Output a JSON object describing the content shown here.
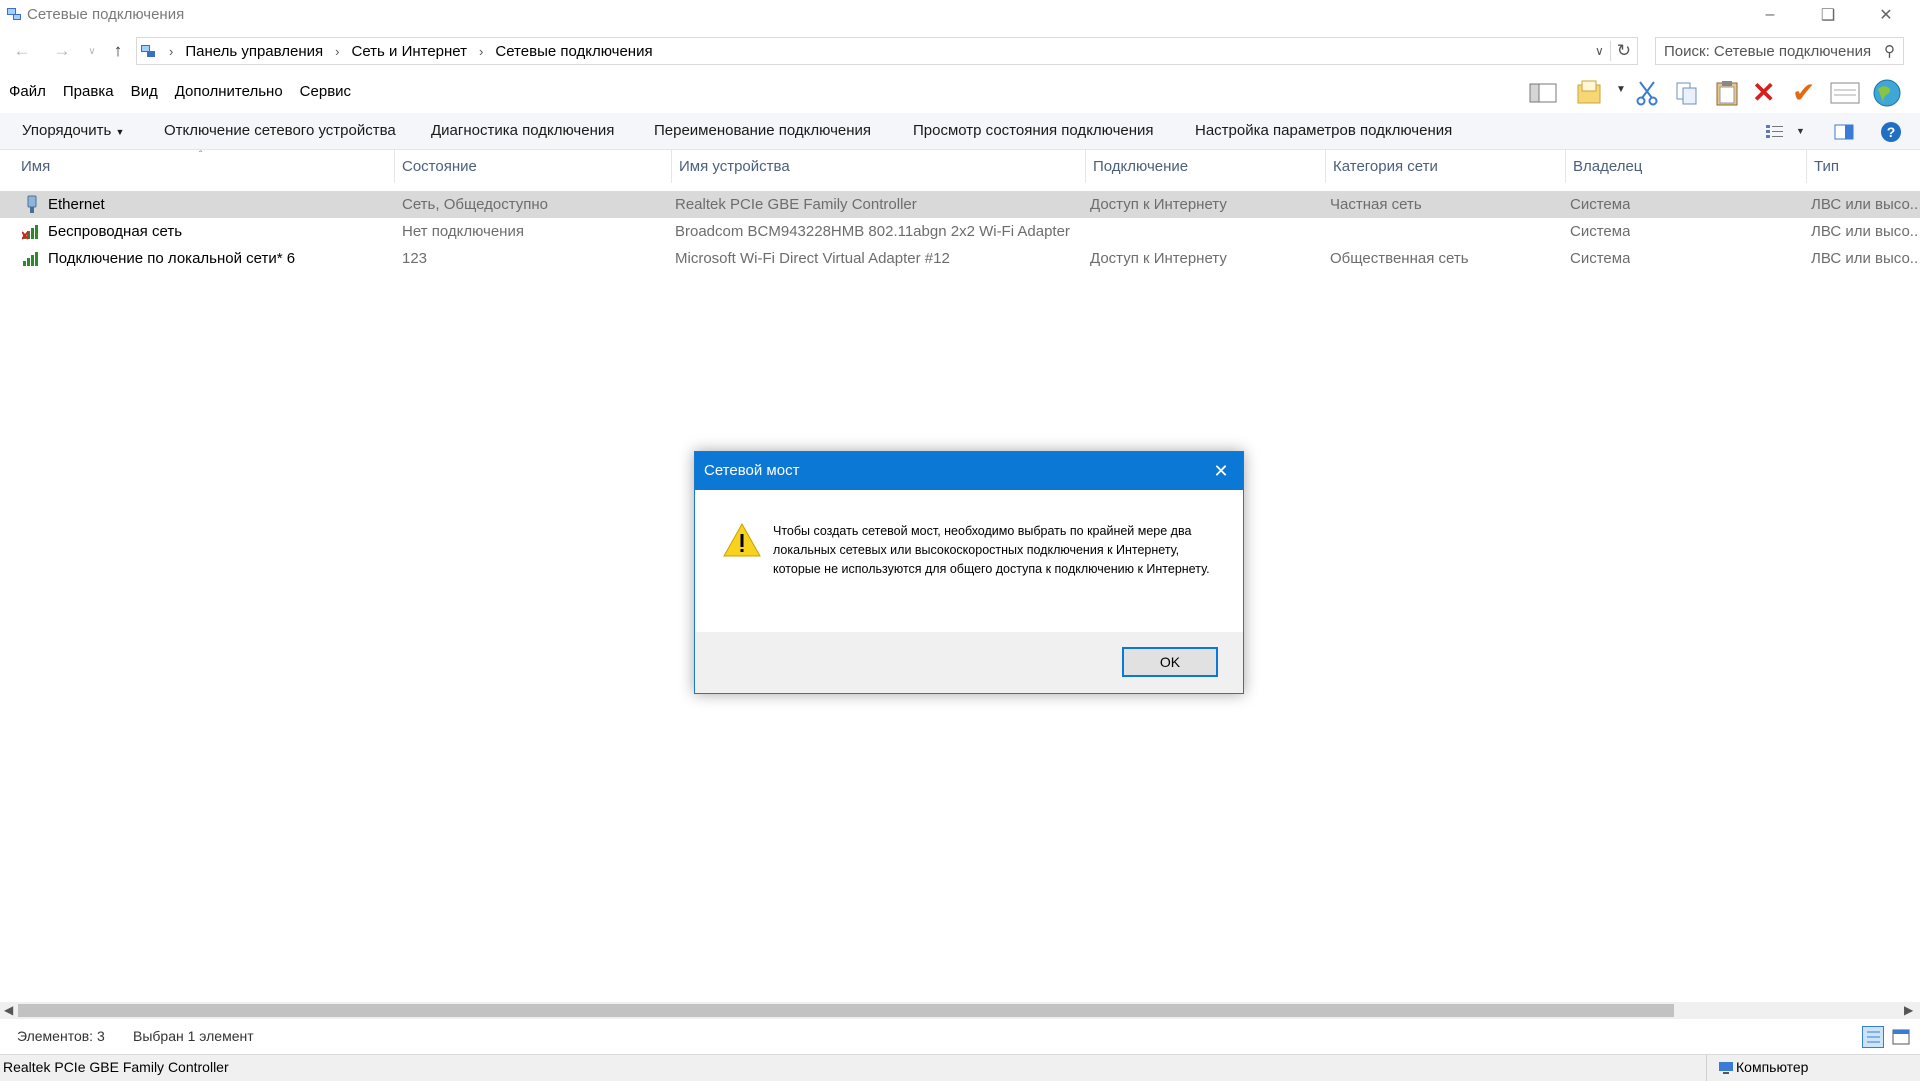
{
  "window": {
    "title": "Сетевые подключения"
  },
  "address": {
    "crumbs": [
      "Панель управления",
      "Сеть и Интернет",
      "Сетевые подключения"
    ],
    "search_placeholder": "Поиск: Сетевые подключения"
  },
  "menu": [
    "Файл",
    "Правка",
    "Вид",
    "Дополнительно",
    "Сервис"
  ],
  "commands": {
    "organize": "Упорядочить",
    "disable": "Отключение сетевого устройства",
    "diagnose": "Диагностика подключения",
    "rename": "Переименование подключения",
    "status": "Просмотр состояния подключения",
    "settings": "Настройка параметров подключения"
  },
  "columns": [
    "Имя",
    "Состояние",
    "Имя устройства",
    "Подключение",
    "Категория сети",
    "Владелец",
    "Тип"
  ],
  "rows": [
    {
      "name": "Ethernet",
      "state": "Сеть, Общедоступно",
      "device": "Realtek PCIe GBE Family Controller",
      "connection": "Доступ к Интернету",
      "category": "Частная сеть",
      "owner": "Система",
      "type": "ЛВС или высо..."
    },
    {
      "name": "Беспроводная сеть",
      "state": "Нет подключения",
      "device": "Broadcom BCM943228HMB 802.11abgn 2x2 Wi-Fi Adapter",
      "connection": "",
      "category": "",
      "owner": "Система",
      "type": "ЛВС или высо..."
    },
    {
      "name": "Подключение по локальной сети* 6",
      "state": "123",
      "device": "Microsoft Wi-Fi Direct Virtual Adapter #12",
      "connection": "Доступ к Интернету",
      "category": "Общественная сеть",
      "owner": "Система",
      "type": "ЛВС или высо..."
    }
  ],
  "dialog": {
    "title": "Сетевой мост",
    "message": "Чтобы создать сетевой мост, необходимо выбрать по крайней мере два локальных сетевых или высокоскоростных подключения к Интернету, которые не используются для общего доступа к подключению к Интернету.",
    "ok": "OK"
  },
  "status": {
    "items": "Элементов: 3",
    "selected": "Выбран 1 элемент",
    "device": "Realtek PCIe GBE Family Controller",
    "location": "Компьютер"
  },
  "colors": {
    "accent": "#0b78d6",
    "selected_row": "#d9d9d9"
  }
}
